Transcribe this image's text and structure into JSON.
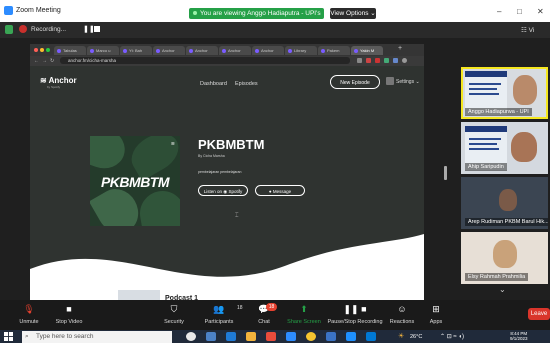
{
  "window": {
    "title": "Zoom Meeting",
    "minimize": "–",
    "maximize": "□",
    "close": "✕"
  },
  "share_banner": {
    "viewing_text": "You are viewing Anggo Hadiaputra - UPI's screen",
    "view_options": "View Options ⌄"
  },
  "recording": {
    "label": "Recording...",
    "pause": "❚❚",
    "view_menu": "☷ Vi"
  },
  "browser": {
    "tabs": [
      "Tabulas",
      "Marco u",
      "Yt: Bah",
      "Anchor",
      "Anchor",
      "Anchor",
      "Anchor",
      "Library",
      "Pakem",
      "Yakin M"
    ],
    "url": "anchor.fm/cicha-marsha",
    "add_tab": "+"
  },
  "anchor": {
    "logo": "Anchor",
    "by_spotify": "by Spotify",
    "nav": [
      "Dashboard",
      "Episodes"
    ],
    "new_episode": "New Episode",
    "settings": "Settings ⌄",
    "podcast_title": "PKBMBTM",
    "author": "By Cicha Marsha",
    "description": "pembelajaran pembelajaran",
    "listen_button": "Listen on ◉ Spotify",
    "message_button": "● Message",
    "cover_text": "PKBMBTM",
    "episode_title": "Podcast 1"
  },
  "participants": [
    {
      "name": "Anggo Hadiapurwa - UPI",
      "active": true
    },
    {
      "name": "Ahip Saripudin",
      "active": false
    },
    {
      "name": "Arep Rudiman PKBM Barul Hik...",
      "active": false
    },
    {
      "name": "Elsy Rahmah Prahmilia",
      "active": false
    }
  ],
  "participants_more": "⌄",
  "toolbar": {
    "unmute": "Unmute",
    "stop_video": "Stop Video",
    "security": "Security",
    "participants": "Participants",
    "participants_count": "18",
    "chat": "Chat",
    "chat_badge": "18",
    "share_screen": "Share Screen",
    "recording": "Pause/Stop Recording",
    "reactions": "Reactions",
    "apps": "Apps",
    "leave": "Leave"
  },
  "taskbar": {
    "search_placeholder": "Type here to search",
    "temperature": "26°C",
    "time": "8:44 PM",
    "date": "9/1/2023"
  },
  "colors": {
    "zoom_blue": "#2d8cff",
    "share_green": "#25a047",
    "leave_red": "#d9352b",
    "active_speaker": "#f5e71f"
  }
}
